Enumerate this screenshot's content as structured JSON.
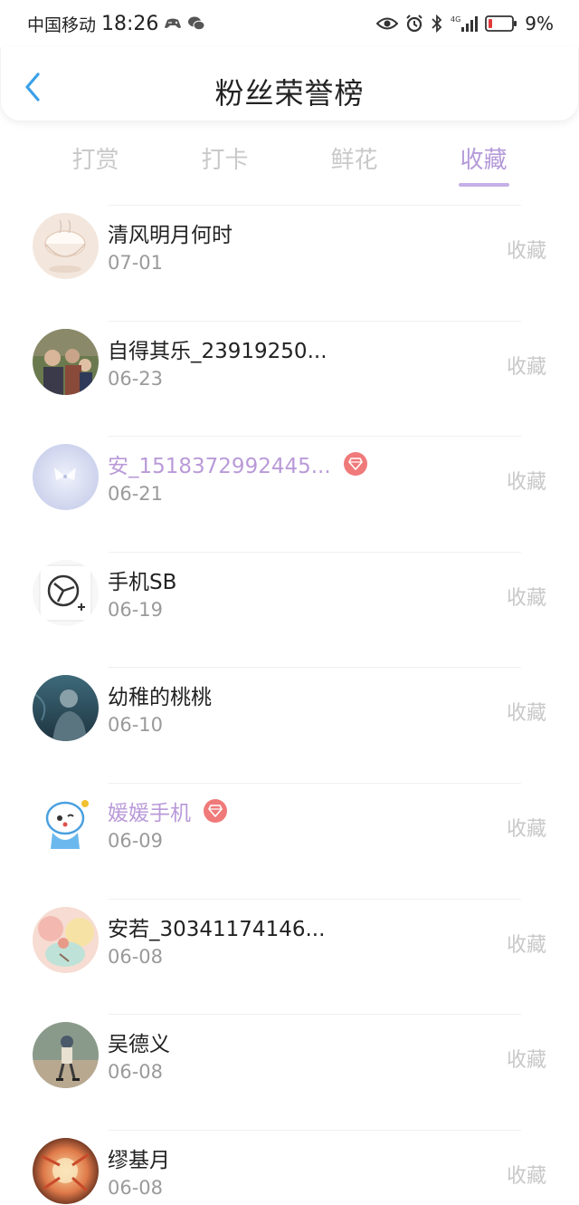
{
  "status_bar": {
    "carrier": "中国移动",
    "time": "18:26",
    "battery": "9%",
    "icons": [
      "gamepad-icon",
      "wechat-icon",
      "eye-icon",
      "alarm-icon",
      "bluetooth-icon",
      "signal-4g-icon",
      "battery-icon"
    ]
  },
  "header": {
    "title": "粉丝荣誉榜",
    "back_icon": "chevron-left-icon"
  },
  "tabs": [
    {
      "label": "打赏",
      "active": false
    },
    {
      "label": "打卡",
      "active": false
    },
    {
      "label": "鲜花",
      "active": false
    },
    {
      "label": "收藏",
      "active": true
    }
  ],
  "colors": {
    "accent": "#b59ad9",
    "back": "#3aa0e8",
    "vip_badge": "#f07a7a",
    "muted": "#c8c8c8"
  },
  "fans": [
    {
      "name": "清风明月何时",
      "date": "07-01",
      "action": "收藏",
      "vip": false
    },
    {
      "name": "自得其乐_23919250...",
      "date": "06-23",
      "action": "收藏",
      "vip": false
    },
    {
      "name": "安_1518372992445...",
      "date": "06-21",
      "action": "收藏",
      "vip": true
    },
    {
      "name": "手机SB",
      "date": "06-19",
      "action": "收藏",
      "vip": false
    },
    {
      "name": "幼稚的桃桃",
      "date": "06-10",
      "action": "收藏",
      "vip": false
    },
    {
      "name": "媛媛手机",
      "date": "06-09",
      "action": "收藏",
      "vip": true
    },
    {
      "name": "安若_30341174146...",
      "date": "06-08",
      "action": "收藏",
      "vip": false
    },
    {
      "name": "吴德义",
      "date": "06-08",
      "action": "收藏",
      "vip": false
    },
    {
      "name": "缪基月",
      "date": "06-08",
      "action": "收藏",
      "vip": false
    }
  ]
}
